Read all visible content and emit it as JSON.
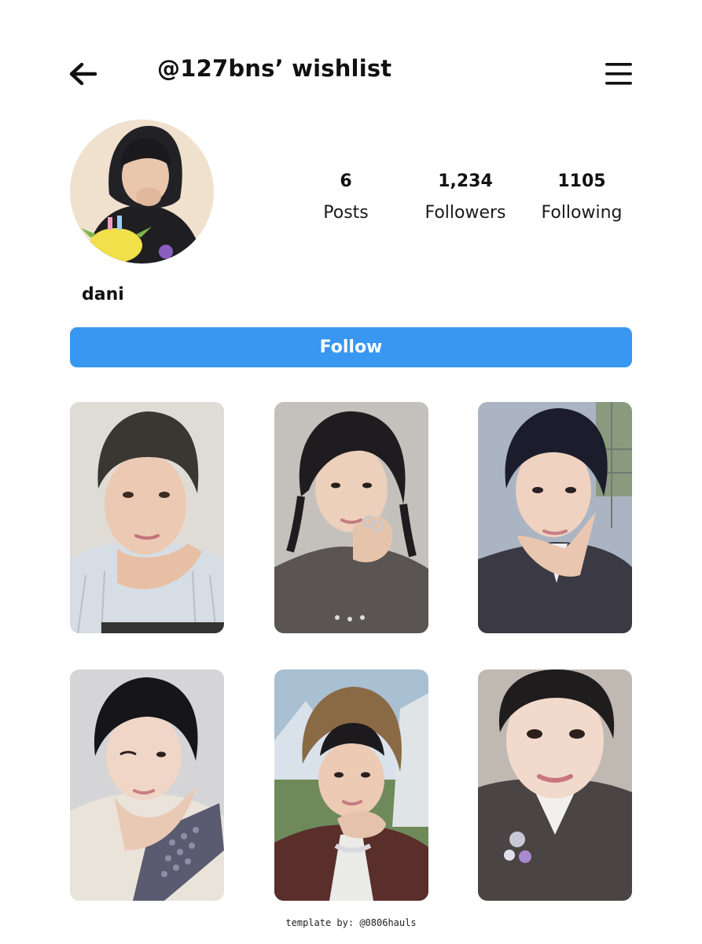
{
  "header": {
    "title": "@127bns’ wishlist",
    "back_icon": "arrow-left-icon",
    "menu_icon": "hamburger-menu-icon"
  },
  "profile": {
    "username": "dani",
    "stats": {
      "posts": {
        "value": "6",
        "label": "Posts"
      },
      "followers": {
        "value": "1,234",
        "label": "Followers"
      },
      "following": {
        "value": "1105",
        "label": "Following"
      }
    }
  },
  "actions": {
    "follow_label": "Follow"
  },
  "grid": {
    "post_count": 6
  },
  "footer": {
    "credit": "template by: @0806hauls"
  },
  "colors": {
    "accent": "#3897f0",
    "text": "#111111",
    "background": "#ffffff"
  }
}
